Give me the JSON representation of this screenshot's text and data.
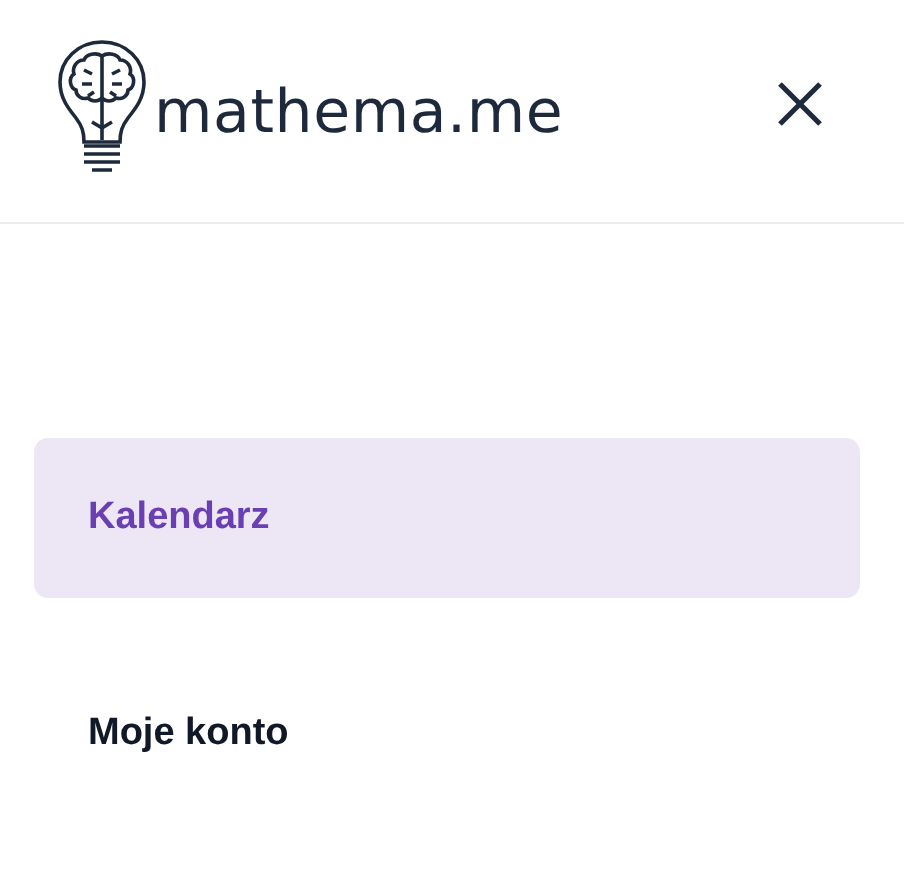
{
  "header": {
    "logo_text": "mathema.me"
  },
  "menu": [
    {
      "label": "Kalendarz",
      "selected": true
    },
    {
      "label": "Moje konto",
      "selected": false
    }
  ]
}
